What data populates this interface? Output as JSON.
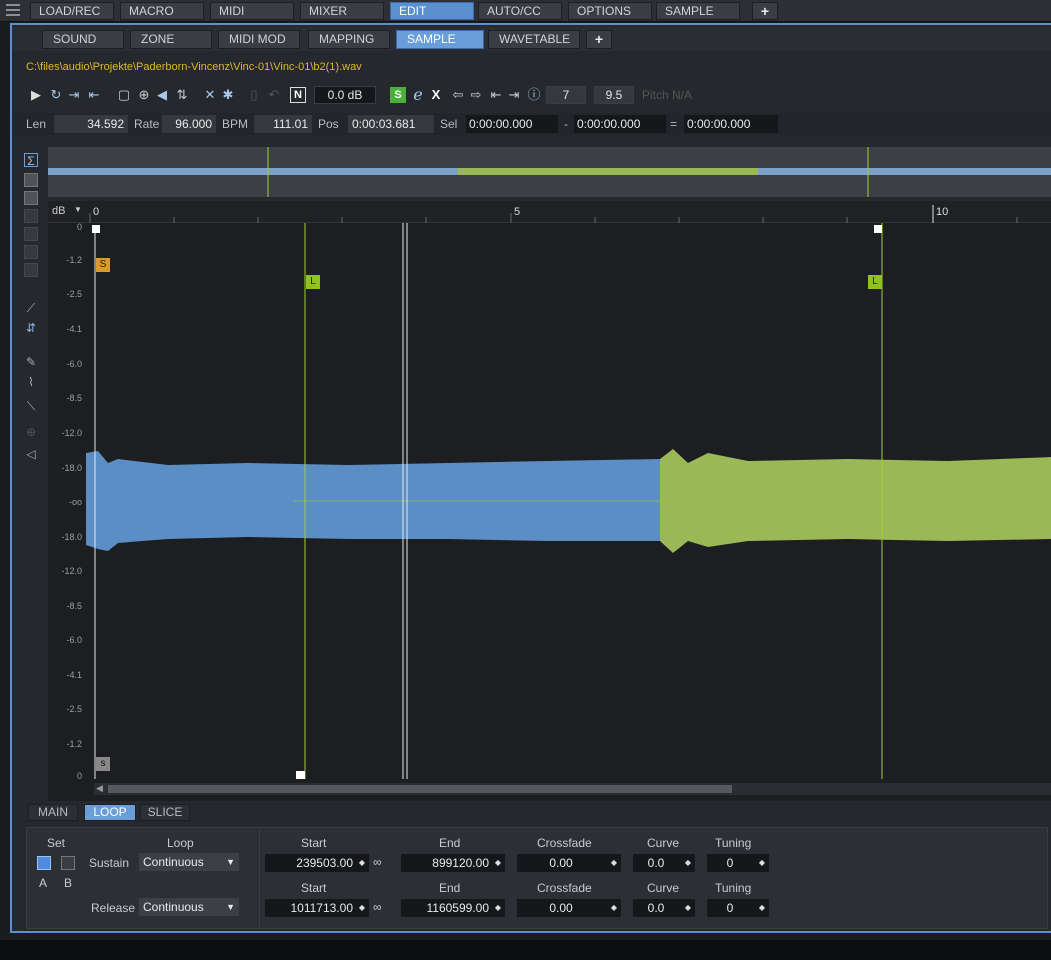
{
  "top_tabs": [
    {
      "label": "LOAD/REC"
    },
    {
      "label": "MACRO"
    },
    {
      "label": "MIDI"
    },
    {
      "label": "MIXER"
    },
    {
      "label": "EDIT"
    },
    {
      "label": "AUTO/CC"
    },
    {
      "label": "OPTIONS"
    },
    {
      "label": "SAMPLE"
    }
  ],
  "plus_label": "+",
  "sub_tabs": [
    {
      "label": "SOUND"
    },
    {
      "label": "ZONE"
    },
    {
      "label": "MIDI MOD"
    },
    {
      "label": "MAPPING"
    },
    {
      "label": "SAMPLE"
    },
    {
      "label": "WAVETABLE"
    }
  ],
  "file_path": "C:\\files\\audio\\Projekte\\Paderborn-Vincenz\\Vinc-01\\Vinc-01\\b2(1).wav",
  "toolbar": {
    "gain": "0.0 dB",
    "n_label": "N",
    "s_label": "S",
    "e_label": "e",
    "x_label": "X",
    "zoom_value": "7",
    "zoom_value2": "9.5",
    "pitch": "Pitch  N/A"
  },
  "info": {
    "len_label": "Len",
    "len_value": "34.592",
    "rate_label": "Rate",
    "rate_value": "96.000",
    "bpm_label": "BPM",
    "bpm_value": "111.01",
    "pos_label": "Pos",
    "pos_value": "0:00:03.681",
    "sel_label": "Sel",
    "sel_start": "0:00:00.000",
    "sel_dash": "-",
    "sel_end": "0:00:00.000",
    "sel_eq": "=",
    "sel_len": "0:00:00.000"
  },
  "ruler": {
    "db_label": "dB",
    "ticks": [
      "0",
      "5",
      "10"
    ]
  },
  "db_ticks": [
    "0",
    "-1.2",
    "-2.5",
    "-4.1",
    "-6.0",
    "-8.5",
    "-12.0",
    "-18.0",
    "-oo",
    "-18.0",
    "-12.0",
    "-8.5",
    "-6.0",
    "-4.1",
    "-2.5",
    "-1.2",
    "0"
  ],
  "markers": {
    "sample_start": "S",
    "loop": "L",
    "sample_end": "s"
  },
  "bottom_tabs": [
    {
      "label": "MAIN"
    },
    {
      "label": "LOOP"
    },
    {
      "label": "SLICE"
    }
  ],
  "loop": {
    "set_label": "Set",
    "loop_label": "Loop",
    "a_label": "A",
    "b_label": "B",
    "sustain_label": "Sustain",
    "sustain_mode": "Continuous",
    "release_label": "Release",
    "release_mode": "Continuous",
    "start_label": "Start",
    "end_label": "End",
    "crossfade_label": "Crossfade",
    "curve_label": "Curve",
    "tuning_label": "Tuning",
    "sustain": {
      "start": "239503.00",
      "end": "899120.00",
      "crossfade": "0.00",
      "curve": "0.0",
      "tuning": "0"
    },
    "release": {
      "start": "1011713.00",
      "end": "1160599.00",
      "crossfade": "0.00",
      "curve": "0.0",
      "tuning": "0"
    }
  },
  "colors": {
    "accent": "#5a8fd0",
    "waveform": "#5b8ec4",
    "loop_waveform": "#9bb857",
    "loop_marker": "#9fd22e",
    "path": "#e0b830"
  }
}
